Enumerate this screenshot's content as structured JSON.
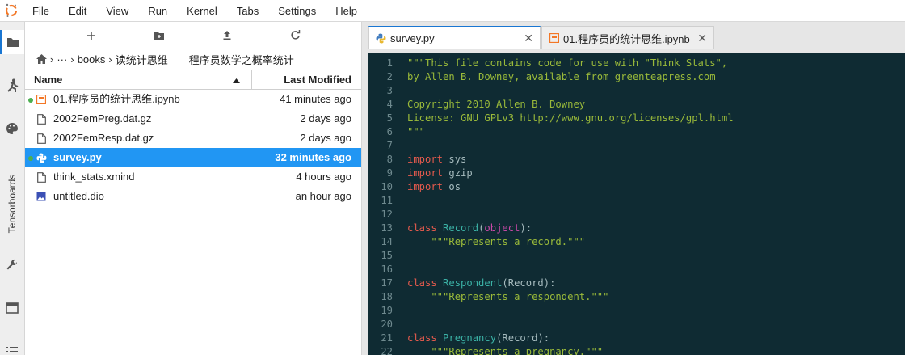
{
  "menu": [
    "File",
    "Edit",
    "View",
    "Run",
    "Kernel",
    "Tabs",
    "Settings",
    "Help"
  ],
  "activity": {
    "tensorboards_label": "Tensorboards"
  },
  "breadcrumb": {
    "ellipsis": "···",
    "books": "books",
    "folder": "读统计思维——程序员数学之概率统计"
  },
  "filebrowser": {
    "col_name": "Name",
    "col_modified": "Last Modified",
    "files": [
      {
        "name": "01.程序员的统计思维.ipynb",
        "modified": "41 minutes ago",
        "running": true,
        "type": "notebook",
        "selected": false
      },
      {
        "name": "2002FemPreg.dat.gz",
        "modified": "2 days ago",
        "running": false,
        "type": "file",
        "selected": false
      },
      {
        "name": "2002FemResp.dat.gz",
        "modified": "2 days ago",
        "running": false,
        "type": "file",
        "selected": false
      },
      {
        "name": "survey.py",
        "modified": "32 minutes ago",
        "running": true,
        "type": "python",
        "selected": true
      },
      {
        "name": "think_stats.xmind",
        "modified": "4 hours ago",
        "running": false,
        "type": "file",
        "selected": false
      },
      {
        "name": "untitled.dio",
        "modified": "an hour ago",
        "running": false,
        "type": "image",
        "selected": false
      }
    ]
  },
  "tabs": [
    {
      "label": "survey.py",
      "active": true
    },
    {
      "label": "01.程序员的统计思维.ipynb",
      "active": false
    }
  ],
  "code": {
    "lines": [
      {
        "n": "1",
        "parts": [
          [
            "\"\"\"This file contains code for use with \"Think Stats\",",
            "doc"
          ]
        ]
      },
      {
        "n": "2",
        "parts": [
          [
            "by Allen B. Downey, available from greenteapress.com",
            "doc"
          ]
        ]
      },
      {
        "n": "3",
        "parts": []
      },
      {
        "n": "4",
        "parts": [
          [
            "Copyright 2010 Allen B. Downey",
            "doc"
          ]
        ]
      },
      {
        "n": "5",
        "parts": [
          [
            "License: GNU GPLv3 http://www.gnu.org/licenses/gpl.html",
            "doc"
          ]
        ]
      },
      {
        "n": "6",
        "parts": [
          [
            "\"\"\"",
            "doc"
          ]
        ]
      },
      {
        "n": "7",
        "parts": []
      },
      {
        "n": "8",
        "parts": [
          [
            "import",
            "kw"
          ],
          [
            " sys",
            "plain"
          ]
        ]
      },
      {
        "n": "9",
        "parts": [
          [
            "import",
            "kw"
          ],
          [
            " gzip",
            "plain"
          ]
        ]
      },
      {
        "n": "10",
        "parts": [
          [
            "import",
            "kw"
          ],
          [
            " os",
            "plain"
          ]
        ]
      },
      {
        "n": "11",
        "parts": []
      },
      {
        "n": "12",
        "parts": []
      },
      {
        "n": "13",
        "parts": [
          [
            "class",
            "kw"
          ],
          [
            " ",
            "plain"
          ],
          [
            "Record",
            "cls"
          ],
          [
            "(",
            "plain"
          ],
          [
            "object",
            "builtin"
          ],
          [
            "):",
            "plain"
          ]
        ]
      },
      {
        "n": "14",
        "parts": [
          [
            "    \"\"\"Represents a record.\"\"\"",
            "doc"
          ]
        ]
      },
      {
        "n": "15",
        "parts": []
      },
      {
        "n": "16",
        "parts": []
      },
      {
        "n": "17",
        "parts": [
          [
            "class",
            "kw"
          ],
          [
            " ",
            "plain"
          ],
          [
            "Respondent",
            "cls"
          ],
          [
            "(Record):",
            "plain"
          ]
        ]
      },
      {
        "n": "18",
        "parts": [
          [
            "    \"\"\"Represents a respondent.\"\"\"",
            "doc"
          ]
        ]
      },
      {
        "n": "19",
        "parts": []
      },
      {
        "n": "20",
        "parts": []
      },
      {
        "n": "21",
        "parts": [
          [
            "class",
            "kw"
          ],
          [
            " ",
            "plain"
          ],
          [
            "Pregnancy",
            "cls"
          ],
          [
            "(Record):",
            "plain"
          ]
        ]
      },
      {
        "n": "22",
        "parts": [
          [
            "    \"\"\"Represents a pregnancy.\"\"\"",
            "doc"
          ]
        ]
      }
    ]
  },
  "colors": {
    "accent": "#2196f3",
    "editor_bg": "#0f2b33",
    "running_dot": "#4caf50",
    "notebook_icon": "#f37726"
  }
}
